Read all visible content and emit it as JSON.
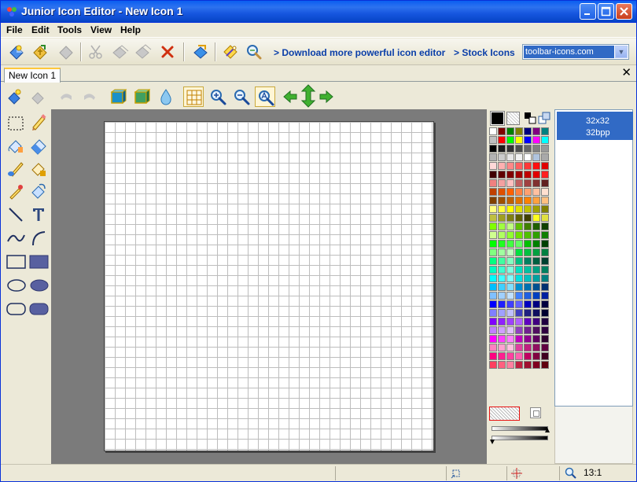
{
  "window": {
    "title": "Junior Icon Editor - New Icon 1",
    "minimize_glyph": "_",
    "maximize_glyph": "□",
    "close_glyph": "✕"
  },
  "menu": {
    "file": "File",
    "edit": "Edit",
    "tools": "Tools",
    "view": "View",
    "help": "Help"
  },
  "toolbar": {
    "icons": [
      "new-icon",
      "open-icon",
      "save-icon",
      "cut-icon",
      "copy-icon",
      "paste-icon",
      "delete-icon",
      "import-icon",
      "wand-icon",
      "search-icon"
    ],
    "download_link": "> Download more powerful icon editor",
    "stock_link": "> Stock Icons",
    "url_value": "toolbar-icons.com"
  },
  "tabs": {
    "document_tab": "New Icon 1",
    "close_glyph": "✕"
  },
  "formats": {
    "selected_line1": "32x32",
    "selected_line2": "32bpp"
  },
  "status": {
    "zoom": "13:1"
  },
  "palette": {
    "rows": [
      [
        "#ffffff",
        "#800000",
        "#008000",
        "#808000",
        "#000080",
        "#800080",
        "#008080"
      ],
      [
        "#c0c0c0",
        "#ff0000",
        "#00ff00",
        "#ffff00",
        "#0000ff",
        "#ff00ff",
        "#00ffff"
      ],
      [
        "#000000",
        "#1c1c1c",
        "#333333",
        "#4d4d4d",
        "#666666",
        "#808080",
        "#999999"
      ],
      [
        "#b3b3b3",
        "#cccccc",
        "#e6e6e6",
        "#f2f2f2",
        "#ffffff",
        "#b0c4de",
        "#a9a9a9"
      ],
      [
        "#ffd8d8",
        "#ffb0b0",
        "#ff8888",
        "#ff6060",
        "#ff3838",
        "#ff1010",
        "#e00000"
      ],
      [
        "#400000",
        "#600000",
        "#800000",
        "#a00000",
        "#c00000",
        "#e00000",
        "#ff2020"
      ],
      [
        "#f08080",
        "#f4a0a0",
        "#ffc0c0",
        "#c06060",
        "#a04040",
        "#803030",
        "#602020"
      ],
      [
        "#c04000",
        "#e05000",
        "#ff6000",
        "#ff8040",
        "#ffa070",
        "#ffc0a0",
        "#ffe0d0"
      ],
      [
        "#804000",
        "#a05000",
        "#c06000",
        "#e07000",
        "#ff8000",
        "#ffa040",
        "#ffc080"
      ],
      [
        "#ffff80",
        "#ffff40",
        "#ffff00",
        "#e0e000",
        "#c0c000",
        "#a0a000",
        "#808000"
      ],
      [
        "#c0c040",
        "#a0a020",
        "#808010",
        "#606000",
        "#404000",
        "#ffff20",
        "#e0e040"
      ],
      [
        "#80ff00",
        "#a0ff40",
        "#c0ff80",
        "#60c000",
        "#408000",
        "#206000",
        "#104000"
      ],
      [
        "#d0ff90",
        "#b0ff60",
        "#90ff30",
        "#70e000",
        "#50c000",
        "#30a000",
        "#108000"
      ],
      [
        "#00ff00",
        "#20ff20",
        "#40ff40",
        "#60ff60",
        "#00c000",
        "#008000",
        "#004000"
      ],
      [
        "#80ff80",
        "#a0ffa0",
        "#c0ffc0",
        "#00e040",
        "#00c040",
        "#00a040",
        "#008040"
      ],
      [
        "#00ff80",
        "#40ffa0",
        "#80ffc0",
        "#00c080",
        "#008060",
        "#006040",
        "#004030"
      ],
      [
        "#00ffc0",
        "#40ffd0",
        "#80ffe0",
        "#00e0c0",
        "#00c0a0",
        "#00a080",
        "#008060"
      ],
      [
        "#00ffff",
        "#40ffff",
        "#80ffff",
        "#00e0e0",
        "#00c0c0",
        "#00a0a0",
        "#008080"
      ],
      [
        "#00c0ff",
        "#40d0ff",
        "#80e0ff",
        "#0090d0",
        "#0070b0",
        "#005090",
        "#003070"
      ],
      [
        "#80c0ff",
        "#a0d0ff",
        "#c0e0ff",
        "#4080ff",
        "#2060e0",
        "#0040c0",
        "#0020a0"
      ],
      [
        "#0000ff",
        "#2020ff",
        "#4040ff",
        "#6060ff",
        "#0000c0",
        "#000080",
        "#000040"
      ],
      [
        "#8080ff",
        "#a0a0ff",
        "#c0c0ff",
        "#4040c0",
        "#202080",
        "#101060",
        "#000030"
      ],
      [
        "#8000ff",
        "#9020ff",
        "#a040ff",
        "#b060ff",
        "#6000c0",
        "#400080",
        "#200040"
      ],
      [
        "#c080ff",
        "#d0a0ff",
        "#e0c0ff",
        "#9040c0",
        "#702090",
        "#501060",
        "#300040"
      ],
      [
        "#ff00ff",
        "#ff40ff",
        "#ff80ff",
        "#c000c0",
        "#900090",
        "#600060",
        "#300030"
      ],
      [
        "#ff80c0",
        "#ffa0d0",
        "#ffc0e0",
        "#e040a0",
        "#c02080",
        "#901060",
        "#600040"
      ],
      [
        "#ff0080",
        "#ff2090",
        "#ff40a0",
        "#ff60b0",
        "#c00060",
        "#800040",
        "#400020"
      ],
      [
        "#ff4060",
        "#ff6080",
        "#ff80a0",
        "#c02040",
        "#a01030",
        "#800020",
        "#600010"
      ]
    ]
  }
}
